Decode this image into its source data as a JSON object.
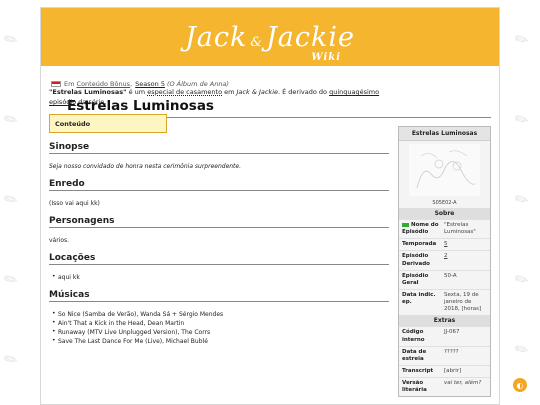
{
  "logo": {
    "main": "Jack",
    "amp": "&",
    "second": "Jackie",
    "sub": "Wiki"
  },
  "breadcrumb": {
    "prefix": "Em",
    "category": "Conteúdo Bônus",
    "separator": ",",
    "season": "Season 5",
    "album": "(O Álbum de Anna)"
  },
  "page_title": "Estrelas Luminosas",
  "intro": {
    "bold": "\"Estrelas Luminosas\"",
    "t1": " é um ",
    "link1": "especial de casamento",
    "t2": " em ",
    "show": "Jack & Jackie",
    "t3": ". É derivado do ",
    "link2": "quinquagésimo episódio",
    "t4": " da série."
  },
  "toc": {
    "label": "Conteúdo"
  },
  "sections": {
    "sinopse": {
      "title": "Sinopse",
      "text": "Seja nosso convidado de honra nesta cerimônia surpreendente."
    },
    "enredo": {
      "title": "Enredo",
      "text": "(Isso vai aqui kk)"
    },
    "personagens": {
      "title": "Personagens",
      "text": "vários."
    },
    "locacoes": {
      "title": "Locações",
      "items": [
        "aqui kk"
      ]
    },
    "musicas": {
      "title": "Músicas",
      "items": [
        "So Nice (Samba de Verão), Wanda Sá + Sérgio Mendes",
        "Ain't That a Kick in the Head, Dean Martin",
        "Runaway (MTV Live Unplugged Version), The Corrs",
        "Save The Last Dance For Me (Live), Michael Bublé"
      ]
    }
  },
  "infobox": {
    "title": "Estrelas Luminosas",
    "caption": "S05E02-A",
    "sobre_label": "Sobre",
    "rows": [
      {
        "k": "Nome do Episódio",
        "v": "\"Estrelas Luminosas\""
      },
      {
        "k": "Temporada",
        "v": "5"
      },
      {
        "k": "Episódio Derivado",
        "v": "2"
      },
      {
        "k": "Episódio Geral",
        "v": "50-A"
      },
      {
        "k": "Data indic. ep.",
        "v": "Sexta, 19 de janeiro de 2018, [horas]"
      }
    ],
    "extras_label": "Extras",
    "extras": [
      {
        "k": "Código interno",
        "v": "JJ-067"
      },
      {
        "k": "Data de estreia",
        "v": "?????"
      },
      {
        "k": "Transcript",
        "v": "[abrir]"
      },
      {
        "k": "Versão literária",
        "v": "vai ter, além?"
      }
    ]
  },
  "colors": {
    "banner": "#f5b52f",
    "toc_bg": "#fdf6c3",
    "accent": "#f5a623"
  }
}
